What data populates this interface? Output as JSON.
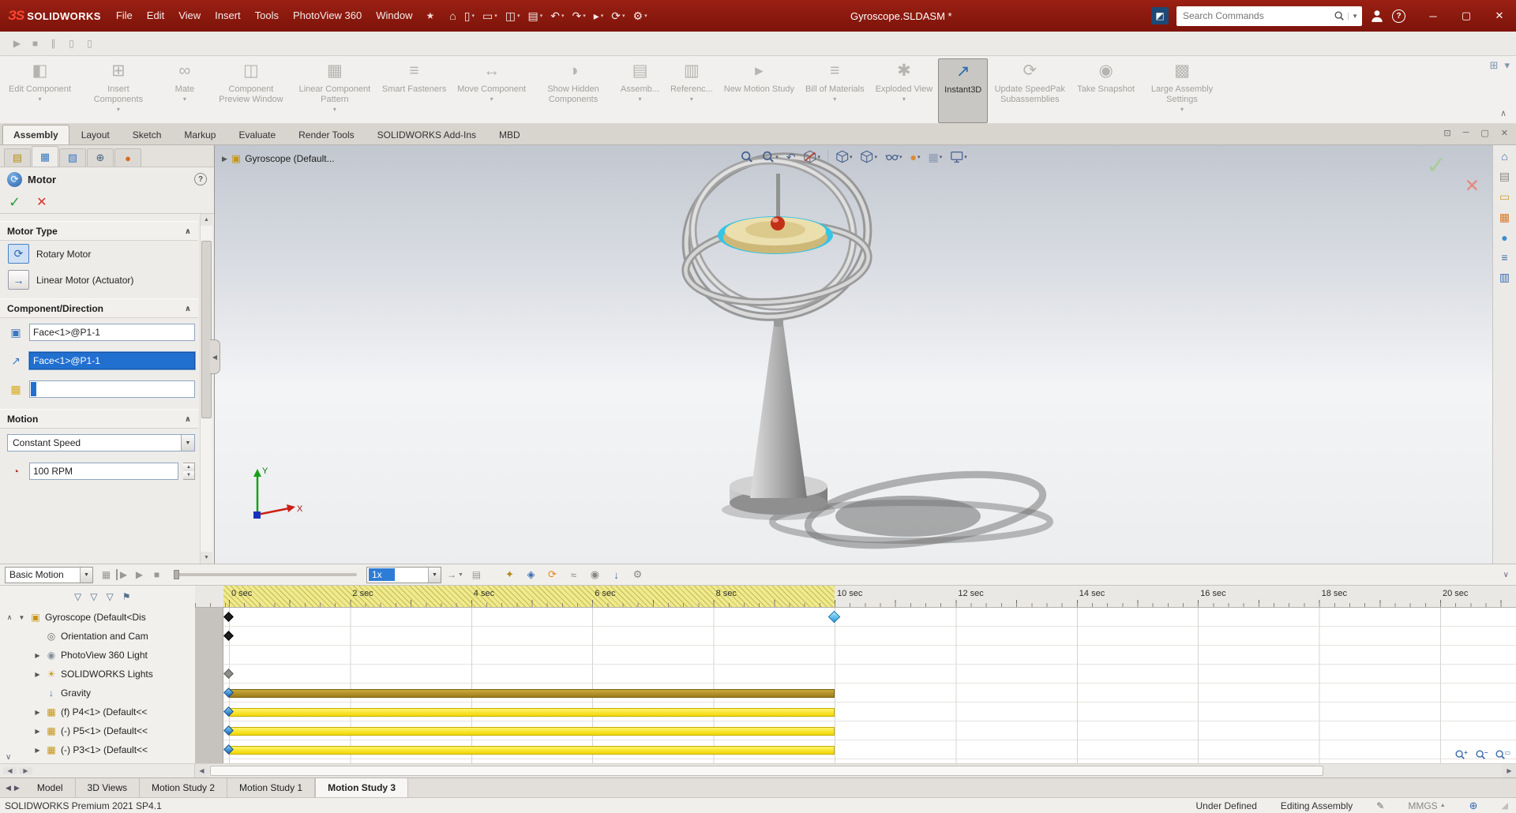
{
  "titlebar": {
    "logo_mark": "ЗS",
    "logo_text": "SOLIDWORKS",
    "menus": [
      "File",
      "Edit",
      "View",
      "Insert",
      "Tools",
      "PhotoView 360",
      "Window"
    ],
    "pin_icon": "★",
    "quick_icons": [
      {
        "name": "home-icon",
        "glyph": "⌂",
        "caret": false
      },
      {
        "name": "new-document-icon",
        "glyph": "▯",
        "caret": true
      },
      {
        "name": "open-document-icon",
        "glyph": "▭",
        "caret": true
      },
      {
        "name": "save-icon",
        "glyph": "◫",
        "caret": true
      },
      {
        "name": "print-icon",
        "glyph": "▤",
        "caret": true
      },
      {
        "name": "undo-icon",
        "glyph": "↶",
        "caret": true
      },
      {
        "name": "redo-icon",
        "glyph": "↷",
        "caret": true
      },
      {
        "name": "select-icon",
        "glyph": "▸",
        "caret": true
      },
      {
        "name": "rebuild-icon",
        "glyph": "⟳",
        "caret": true
      },
      {
        "name": "options-icon",
        "glyph": "⚙",
        "caret": true
      }
    ],
    "doc_title": "Gyroscope.SLDASM *",
    "search_placeholder": "Search Commands",
    "window_controls": [
      "─",
      "▢",
      "✕"
    ]
  },
  "quickbar_icons": [
    {
      "name": "play-icon",
      "glyph": "▶"
    },
    {
      "name": "stop-icon",
      "glyph": "■"
    },
    {
      "name": "pause-icon",
      "glyph": "∥"
    },
    {
      "name": "frame-icon",
      "glyph": "▯"
    },
    {
      "name": "frame2-icon",
      "glyph": "▯"
    }
  ],
  "ribbon": {
    "buttons": [
      {
        "label": "Edit Component",
        "glyph": "◧",
        "dropdown": true,
        "disabled": true
      },
      {
        "label": "Insert Components",
        "glyph": "⊞",
        "dropdown": true,
        "disabled": true
      },
      {
        "label": "Mate",
        "glyph": "∞",
        "dropdown": true,
        "disabled": true
      },
      {
        "label": "Component Preview Window",
        "glyph": "◫",
        "dropdown": false,
        "disabled": true
      },
      {
        "label": "Linear Component Pattern",
        "glyph": "▦",
        "dropdown": true,
        "disabled": true
      },
      {
        "label": "Smart Fasteners",
        "glyph": "≡",
        "dropdown": false,
        "disabled": true
      },
      {
        "label": "Move Component",
        "glyph": "↔",
        "dropdown": true,
        "disabled": true
      },
      {
        "label": "Show Hidden Components",
        "glyph": "◑",
        "dropdown": false,
        "disabled": true
      },
      {
        "label": "Assemb...",
        "glyph": "▤",
        "dropdown": true,
        "disabled": true
      },
      {
        "label": "Referenc...",
        "glyph": "▥",
        "dropdown": true,
        "disabled": true
      },
      {
        "label": "New Motion Study",
        "glyph": "▸",
        "dropdown": false,
        "disabled": true
      },
      {
        "label": "Bill of Materials",
        "glyph": "≡",
        "dropdown": true,
        "disabled": true
      },
      {
        "label": "Exploded View",
        "glyph": "✱",
        "dropdown": true,
        "disabled": true
      },
      {
        "label": "Instant3D",
        "glyph": "↗",
        "dropdown": false,
        "disabled": false,
        "active": true
      },
      {
        "label": "Update SpeedPak Subassemblies",
        "glyph": "⟳",
        "dropdown": false,
        "disabled": true
      },
      {
        "label": "Take Snapshot",
        "glyph": "◉",
        "dropdown": false,
        "disabled": true
      },
      {
        "label": "Large Assembly Settings",
        "glyph": "▩",
        "dropdown": true,
        "disabled": true
      }
    ],
    "collapse_icon": "∧"
  },
  "command_tabs": {
    "items": [
      "Assembly",
      "Layout",
      "Sketch",
      "Markup",
      "Evaluate",
      "Render Tools",
      "SOLIDWORKS Add-Ins",
      "MBD"
    ],
    "active": "Assembly"
  },
  "property_manager": {
    "tabs": [
      {
        "name": "featuremanager-tab",
        "glyph": "▤",
        "color": "#b89010",
        "active": false
      },
      {
        "name": "propertymanager-tab",
        "glyph": "▦",
        "color": "#3a78c0",
        "active": true
      },
      {
        "name": "configurationmanager-tab",
        "glyph": "▧",
        "color": "#3a78c0",
        "active": false
      },
      {
        "name": "dimxpertmanager-tab",
        "glyph": "⊕",
        "color": "#44617e",
        "active": false
      },
      {
        "name": "displaymanager-tab",
        "glyph": "●",
        "color": "#d86820",
        "active": false
      }
    ],
    "title": "Motor",
    "motor_type": {
      "header": "Motor Type",
      "options": [
        "Rotary Motor",
        "Linear Motor (Actuator)"
      ],
      "selected": "Rotary Motor"
    },
    "component_direction": {
      "header": "Component/Direction",
      "fields": [
        {
          "value": "Face<1>@P1-1",
          "selected": false
        },
        {
          "value": "Face<1>@P1-1",
          "selected": true
        },
        {
          "value": "",
          "selected": false
        }
      ]
    },
    "motion": {
      "header": "Motion",
      "profile": "Constant Speed",
      "speed": "100 RPM"
    }
  },
  "viewport": {
    "breadcrumb": "Gyroscope  (Default...",
    "headsup": [
      {
        "name": "zoom-fit-icon",
        "icon": "mag"
      },
      {
        "name": "zoom-area-icon",
        "icon": "mag",
        "caret": true
      },
      {
        "name": "previous-view-icon",
        "glyph": "↶",
        "color": "#44608c"
      },
      {
        "name": "section-view-icon",
        "icon": "section",
        "caret": true
      },
      {
        "sep": true
      },
      {
        "name": "view-orientation-icon",
        "icon": "cube",
        "caret": true
      },
      {
        "name": "display-style-icon",
        "icon": "cube",
        "caret": true
      },
      {
        "name": "hide-show-items-icon",
        "icon": "glasses",
        "caret": true
      },
      {
        "name": "edit-appearance-icon",
        "glyph": "●",
        "color": "#e08830",
        "caret": true
      },
      {
        "name": "apply-scene-icon",
        "glyph": "▦",
        "color": "#8a9ab0",
        "caret": true
      },
      {
        "name": "view-settings-icon",
        "icon": "monitor",
        "caret": true
      }
    ]
  },
  "taskpane_icons": [
    {
      "name": "solidworks-resources-icon",
      "glyph": "⌂",
      "color": "#3a6cb0"
    },
    {
      "name": "design-library-icon",
      "glyph": "▤",
      "color": "#8a8884"
    },
    {
      "name": "file-explorer-icon",
      "glyph": "▭",
      "color": "#c8a030"
    },
    {
      "name": "view-palette-icon",
      "glyph": "▦",
      "color": "#d87828"
    },
    {
      "name": "appearances-scenes-icon",
      "glyph": "●",
      "color": "#3a8fd0"
    },
    {
      "name": "custom-properties-icon",
      "glyph": "≡",
      "color": "#3a6cb0"
    },
    {
      "name": "forum-icon",
      "glyph": "▥",
      "color": "#3a6cb0"
    }
  ],
  "motion_manager": {
    "study_type": "Basic Motion",
    "playback_speed": "1x",
    "transport_icons": [
      {
        "name": "calculate-icon",
        "glyph": "▦"
      },
      {
        "name": "play-from-start-icon",
        "glyph": "▶",
        "bar": true
      },
      {
        "name": "play-icon",
        "glyph": "▶"
      },
      {
        "name": "stop-icon",
        "glyph": "■"
      }
    ],
    "mode_icon": "→",
    "save_animation_icon": "▤",
    "tool_icons": [
      {
        "name": "animation-wizard-icon",
        "glyph": "✦",
        "color": "#b08a20"
      },
      {
        "name": "add-key-icon",
        "glyph": "◈",
        "color": "#3a6cb0"
      },
      {
        "name": "motor-icon",
        "glyph": "⟳",
        "color": "#e08818"
      },
      {
        "name": "spring-icon",
        "glyph": "≈",
        "color": "#888884"
      },
      {
        "name": "contact-icon",
        "glyph": "◉",
        "color": "#888884"
      },
      {
        "name": "gravity-icon",
        "glyph": "↓",
        "color": "#3a6cb0"
      },
      {
        "name": "motion-study-properties-icon",
        "glyph": "⚙",
        "color": "#888884"
      }
    ],
    "filter_icons": [
      {
        "name": "filter-none-icon",
        "glyph": "▽"
      },
      {
        "name": "filter-animated-icon",
        "glyph": "▽"
      },
      {
        "name": "filter-driving-icon",
        "glyph": "▽"
      },
      {
        "name": "filter-results-icon",
        "glyph": "⚑"
      }
    ],
    "ruler": [
      {
        "t": 0,
        "label": "0 sec"
      },
      {
        "t": 2,
        "label": "2 sec"
      },
      {
        "t": 4,
        "label": "4 sec"
      },
      {
        "t": 6,
        "label": "6 sec"
      },
      {
        "t": 8,
        "label": "8 sec"
      },
      {
        "t": 10,
        "label": "10 sec"
      },
      {
        "t": 12,
        "label": "12 sec"
      },
      {
        "t": 14,
        "label": "14 sec"
      },
      {
        "t": 16,
        "label": "16 sec"
      },
      {
        "t": 18,
        "label": "18 sec"
      },
      {
        "t": 20,
        "label": "20 sec"
      }
    ],
    "duration_sec": 10,
    "tree": [
      {
        "label": "Gyroscope  (Default<Dis",
        "icon": "assembly",
        "root": true,
        "arrow": "open",
        "indent": false
      },
      {
        "label": "Orientation and Cam",
        "icon": "camera",
        "indent": true
      },
      {
        "label": "PhotoView 360 Light",
        "icon": "pvlight",
        "indent": true,
        "arrow": "closed"
      },
      {
        "label": "SOLIDWORKS Lights",
        "icon": "swlights",
        "indent": true,
        "arrow": "closed"
      },
      {
        "label": "Gravity",
        "icon": "gravity",
        "indent": true
      },
      {
        "label": "(f) P4<1> (Default<<",
        "icon": "part",
        "indent": true,
        "arrow": "closed"
      },
      {
        "label": "(-) P5<1> (Default<<",
        "icon": "part",
        "indent": true,
        "arrow": "closed"
      },
      {
        "label": "(-) P3<1> (Default<<",
        "icon": "part",
        "indent": true,
        "arrow": "closed"
      }
    ],
    "rows": [
      {
        "keys": [
          {
            "t": 0,
            "c": "black"
          },
          {
            "t": 10,
            "c": "cyan"
          }
        ]
      },
      {
        "keys": [
          {
            "t": 0,
            "c": "black"
          }
        ]
      },
      {
        "keys": []
      },
      {
        "keys": [
          {
            "t": 0,
            "c": "gray"
          }
        ]
      },
      {
        "bar": {
          "s": 0,
          "e": 10,
          "c": "gravity"
        },
        "keys": [
          {
            "t": 0,
            "c": "blue"
          }
        ]
      },
      {
        "bar": {
          "s": 0,
          "e": 10,
          "c": "part"
        },
        "keys": [
          {
            "t": 0,
            "c": "blue"
          }
        ]
      },
      {
        "bar": {
          "s": 0,
          "e": 10,
          "c": "part"
        },
        "keys": [
          {
            "t": 0,
            "c": "blue"
          }
        ]
      },
      {
        "bar": {
          "s": 0,
          "e": 10,
          "c": "part"
        },
        "keys": [
          {
            "t": 0,
            "c": "blue"
          }
        ]
      }
    ]
  },
  "doc_tabs": {
    "items": [
      "Model",
      "3D Views",
      "Motion Study 2",
      "Motion Study 1",
      "Motion Study 3"
    ],
    "active": "Motion Study 3"
  },
  "statusbar": {
    "left": "SOLIDWORKS Premium 2021 SP4.1",
    "constraint_status": "Under Defined",
    "mode": "Editing Assembly",
    "units": "MMGS"
  }
}
